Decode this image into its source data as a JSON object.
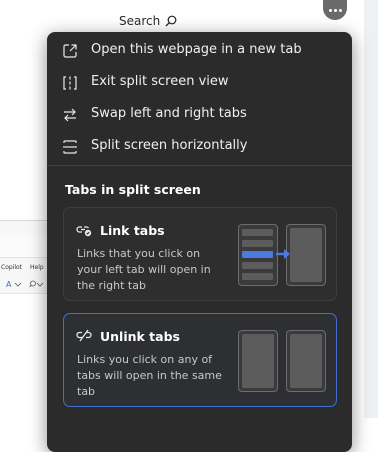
{
  "background": {
    "search_label": "Search",
    "ribbon": {
      "copilot": "Copilot",
      "help": "Help"
    }
  },
  "more_button": {
    "icon": "more-horizontal-icon"
  },
  "menu": {
    "items": [
      {
        "label": "Open this webpage in a new tab",
        "icon": "open-new-tab-icon"
      },
      {
        "label": "Exit split screen view",
        "icon": "exit-split-icon"
      },
      {
        "label": "Swap left and right tabs",
        "icon": "swap-arrows-icon"
      },
      {
        "label": "Split screen horizontally",
        "icon": "split-horizontal-icon"
      }
    ],
    "section_title": "Tabs in split screen",
    "cards": [
      {
        "title": "Link tabs",
        "description": "Links that you click on your left tab will open in the right tab",
        "icon": "link-tabs-icon",
        "selected": false
      },
      {
        "title": "Unlink tabs",
        "description": "Links you click on any of tabs will open in the same tab",
        "icon": "unlink-tabs-icon",
        "selected": true
      }
    ]
  },
  "colors": {
    "menu_bg": "#2b2b2b",
    "accent": "#4b7be0",
    "selected_border": "#3f6fd1"
  }
}
